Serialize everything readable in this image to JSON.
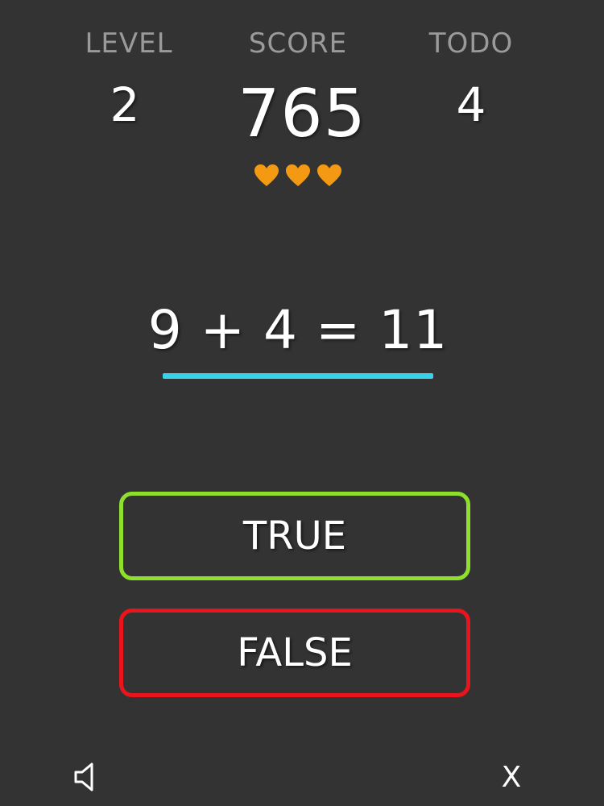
{
  "stats": {
    "level_label": "LEVEL",
    "level_value": "2",
    "score_label": "SCORE",
    "score_value": "765",
    "todo_label": "TODO",
    "todo_value": "4"
  },
  "lives": {
    "count": 3,
    "icon": "heart-icon",
    "color": "#f39a12"
  },
  "question": {
    "equation": "9 + 4 = 11",
    "timer_fraction": 1.0,
    "timer_color": "#37d3e8"
  },
  "answers": {
    "true_label": "TRUE",
    "true_color": "#8ee02c",
    "false_label": "FALSE",
    "false_color": "#e8161c"
  },
  "footer": {
    "sound_icon": "speaker-icon",
    "close_label": "X"
  }
}
